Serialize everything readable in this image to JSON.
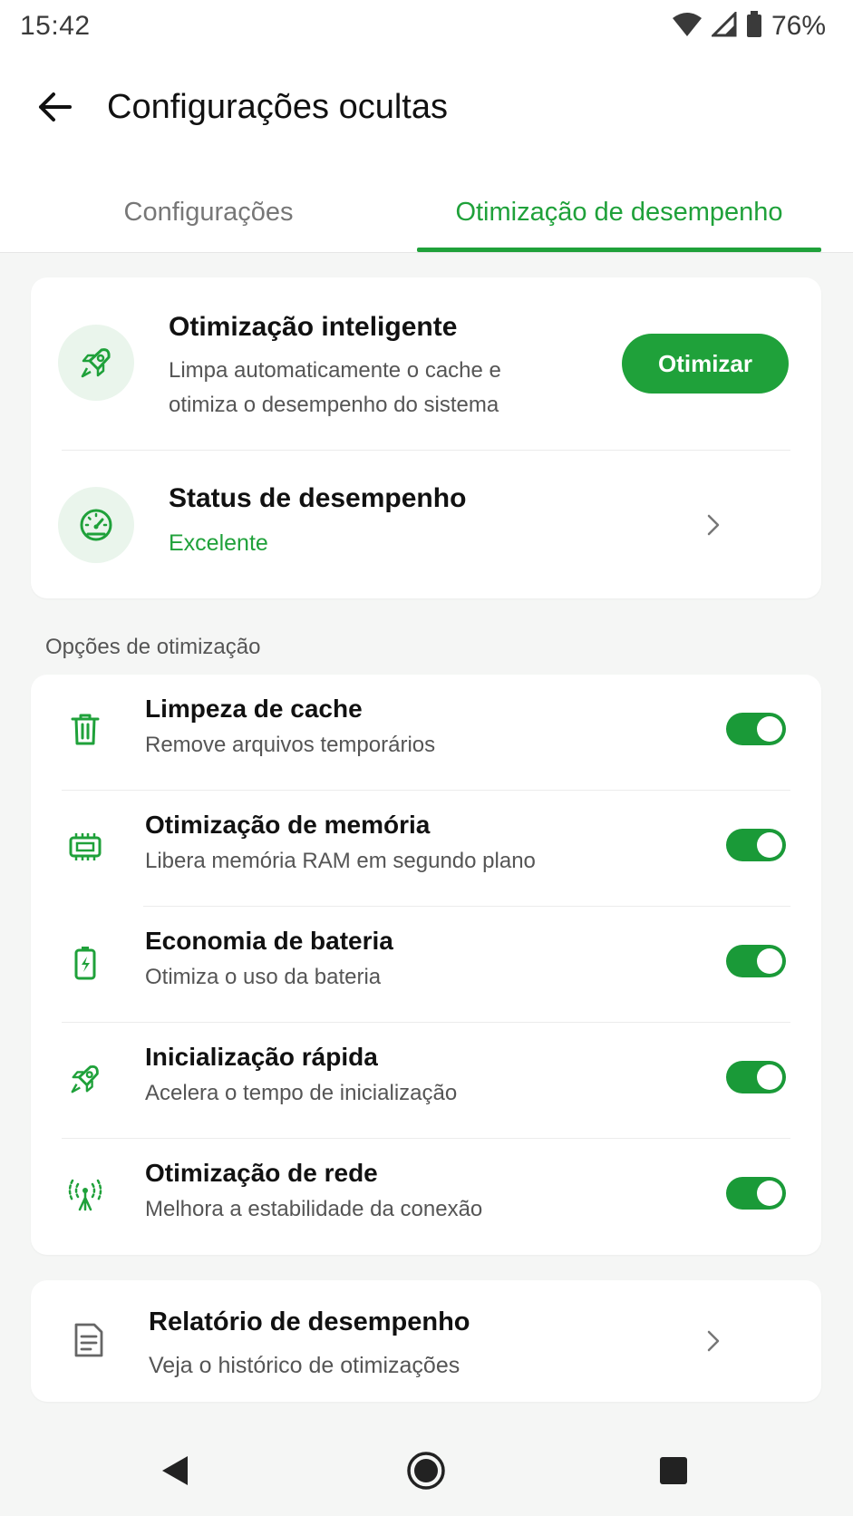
{
  "status_bar": {
    "time": "15:42",
    "battery": "76%"
  },
  "appbar": {
    "title": "Configurações ocultas"
  },
  "tabs": [
    {
      "label": "Configurações",
      "active": false
    },
    {
      "label": "Otimização de desempenho",
      "active": true
    }
  ],
  "smart": {
    "title": "Otimização inteligente",
    "desc_line1": "Limpa automaticamente o cache e",
    "desc_line2": "otimiza o desempenho do sistema",
    "button": "Otimizar"
  },
  "performance_status": {
    "title": "Status de desempenho",
    "value": "Excelente"
  },
  "options_section": {
    "label": "Opções de otimização",
    "items": [
      {
        "title": "Limpeza de cache",
        "desc": "Remove arquivos temporários",
        "icon": "trash-icon",
        "enabled": true
      },
      {
        "title": "Otimização de memória",
        "desc": "Libera memória RAM em segundo plano",
        "icon": "memory-chip-icon",
        "enabled": true
      },
      {
        "title": "Economia de bateria",
        "desc": "Otimiza o uso da bateria",
        "icon": "battery-icon",
        "enabled": true
      },
      {
        "title": "Inicialização rápida",
        "desc": "Acelera o tempo de inicialização",
        "icon": "rocket-icon",
        "enabled": true
      },
      {
        "title": "Otimização de rede",
        "desc": "Melhora a estabilidade da conexão",
        "icon": "antenna-icon",
        "enabled": true
      }
    ]
  },
  "report": {
    "title": "Relatório de desempenho",
    "desc": "Veja o histórico de otimizações"
  },
  "colors": {
    "accent": "#1fa13a",
    "accent_light": "#eaf5ec",
    "background": "#f5f6f5"
  }
}
